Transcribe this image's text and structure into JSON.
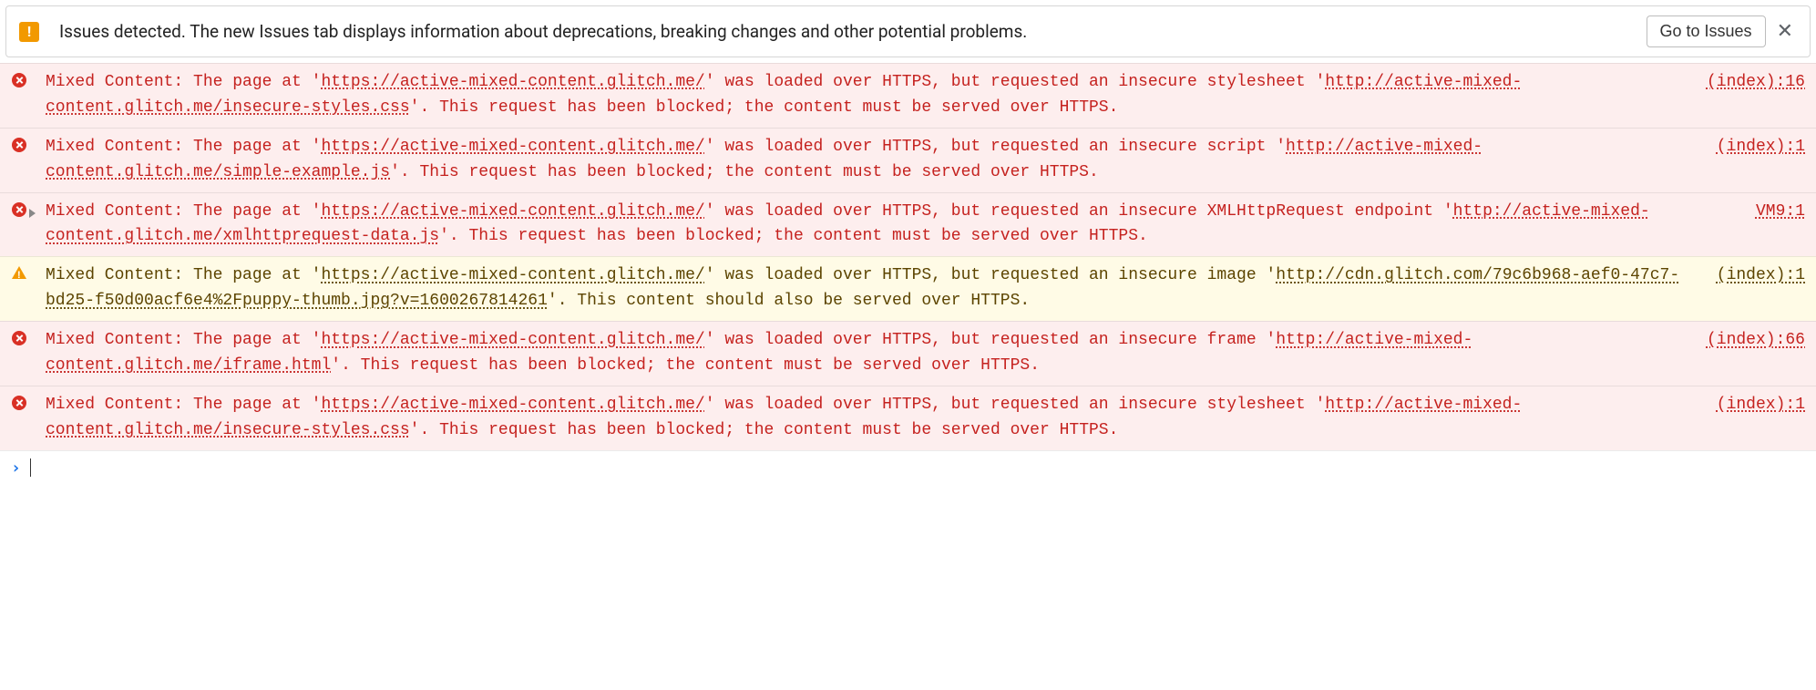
{
  "issues_bar": {
    "text": "Issues detected. The new Issues tab displays information about deprecations, breaking changes and other potential problems.",
    "button_label": "Go to Issues"
  },
  "page_url": "https://active-mixed-content.glitch.me/",
  "entries": [
    {
      "level": "error",
      "expandable": false,
      "pre": "Mixed Content: The page at '",
      "post_url": "' was loaded over HTTPS, but requested an insecure stylesheet '",
      "res_url": "http://active-mixed-content.glitch.me/insecure-styles.css",
      "tail": "'. This request has been blocked; the content must be served over HTTPS.",
      "source": "(index):16"
    },
    {
      "level": "error",
      "expandable": false,
      "pre": "Mixed Content: The page at '",
      "post_url": "' was loaded over HTTPS, but requested an insecure script '",
      "res_url": "http://active-mixed-content.glitch.me/simple-example.js",
      "tail": "'. This request has been blocked; the content must be served over HTTPS.",
      "source": "(index):1"
    },
    {
      "level": "error",
      "expandable": true,
      "pre": "Mixed Content: The page at '",
      "post_url": "' was loaded over HTTPS, but requested an insecure XMLHttpRequest endpoint '",
      "res_url": "http://active-mixed-content.glitch.me/xmlhttprequest-data.js",
      "tail": "'. This request has been blocked; the content must be served over HTTPS.",
      "source": "VM9:1"
    },
    {
      "level": "warning",
      "expandable": false,
      "pre": "Mixed Content: The page at '",
      "post_url": "' was loaded over HTTPS, but requested an insecure image '",
      "res_url": "http://cdn.glitch.com/79c6b968-aef0-47c7-bd25-f50d00acf6e4%2Fpuppy-thumb.jpg?v=1600267814261",
      "tail": "'. This content should also be served over HTTPS.",
      "source": "(index):1"
    },
    {
      "level": "error",
      "expandable": false,
      "pre": "Mixed Content: The page at '",
      "post_url": "' was loaded over HTTPS, but requested an insecure frame '",
      "res_url": "http://active-mixed-content.glitch.me/iframe.html",
      "tail": "'. This request has been blocked; the content must be served over HTTPS.",
      "source": "(index):66"
    },
    {
      "level": "error",
      "expandable": false,
      "pre": "Mixed Content: The page at '",
      "post_url": "' was loaded over HTTPS, but requested an insecure stylesheet '",
      "res_url": "http://active-mixed-content.glitch.me/insecure-styles.css",
      "tail": "'. This request has been blocked; the content must be served over HTTPS.",
      "source": "(index):1"
    }
  ]
}
